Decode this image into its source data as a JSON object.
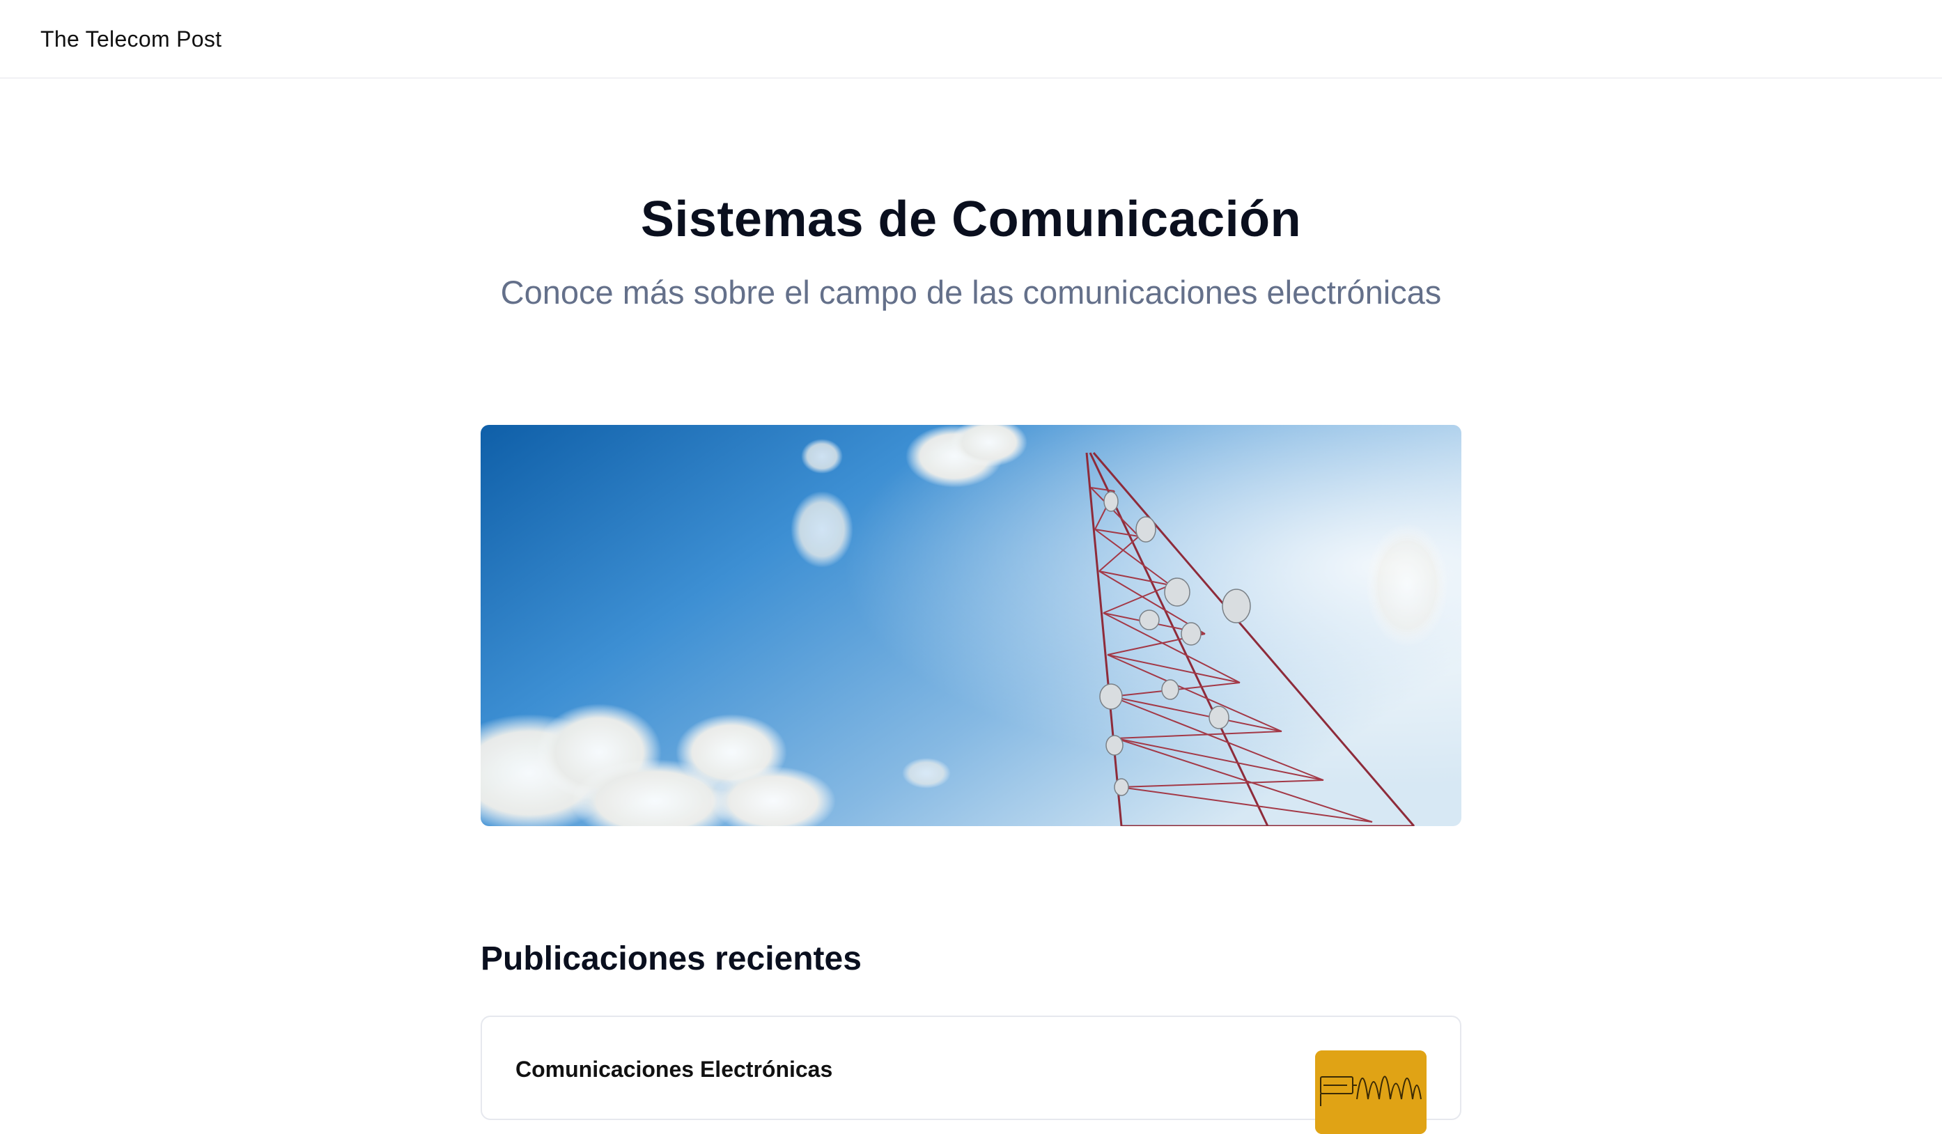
{
  "header": {
    "brand": "The Telecom Post"
  },
  "hero": {
    "title": "Sistemas de Comunicación",
    "subtitle": "Conoce más sobre el campo de las comunicaciones electrónicas",
    "image_alt": "telecom-tower-photo"
  },
  "recent": {
    "heading": "Publicaciones recientes",
    "posts": [
      {
        "title": "Comunicaciones Electrónicas",
        "thumbnail": "signal-diagram-thumbnail"
      }
    ]
  },
  "colors": {
    "title": "#0a0f1e",
    "subtitle": "#64708a",
    "card_border": "#e6e8ee",
    "thumb_bg": "#e0a315"
  }
}
